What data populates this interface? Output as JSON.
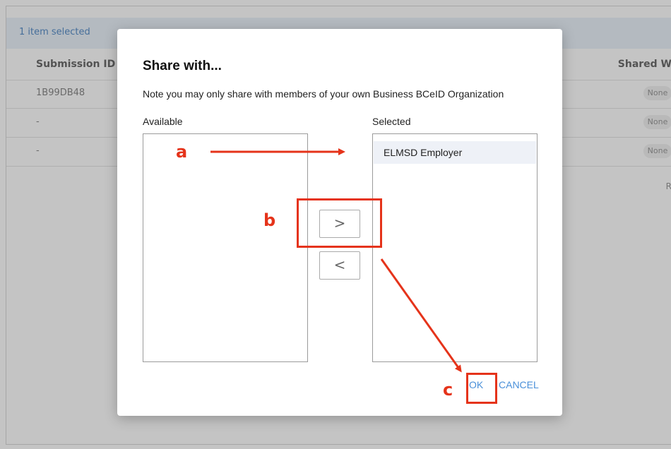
{
  "background": {
    "selection_text": "1 item selected",
    "columns": [
      "Submission ID",
      "Shared W"
    ],
    "rows": [
      {
        "id": "1B99DB48",
        "shared": "None"
      },
      {
        "id": "-",
        "shared": "None"
      },
      {
        "id": "-",
        "shared": "None"
      }
    ],
    "truncated_text": "R"
  },
  "dialog": {
    "title": "Share with...",
    "note": "Note you may only share with members of your own Business BCeID Organization",
    "available_label": "Available",
    "selected_label": "Selected",
    "available_items": [],
    "selected_items": [
      "ELMSD Employer"
    ],
    "move_right_label": ">",
    "move_left_label": "<",
    "ok_label": "OK",
    "cancel_label": "CANCEL"
  },
  "annotations": {
    "letters": [
      "a",
      "b",
      "c"
    ],
    "color": "#e5331a"
  },
  "colors": {
    "accent": "#4a90d9",
    "selection_bar": "#eaf3fa",
    "selected_item": "#eef1f7"
  }
}
